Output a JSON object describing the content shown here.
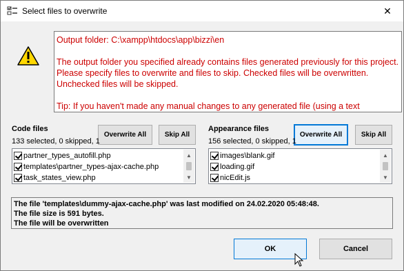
{
  "window": {
    "title": "Select files to overwrite",
    "close_glyph": "✕"
  },
  "message": {
    "line1": "Output folder: C:\\xampp\\htdocs\\app\\bizzi\\en",
    "line2": "The output folder you specified already contains files generated previously for this project. Please specify files to overwrite and files to skip. Checked files will be overwritten. Unchecked files will be skipped.",
    "line3": "Tip: If you haven't made any manual changes to any generated file (using a text"
  },
  "code_files": {
    "label": "Code files",
    "counts": "133 selected, 0 skipped, 1",
    "overwrite_all": "Overwrite All",
    "skip_all": "Skip All",
    "items": [
      {
        "name": "partner_types_autofill.php",
        "checked": true
      },
      {
        "name": "templates\\partner_types-ajax-cache.php",
        "checked": true
      },
      {
        "name": "task_states_view.php",
        "checked": true
      }
    ]
  },
  "appearance_files": {
    "label": "Appearance files",
    "counts": "156 selected, 0 skipped, 1",
    "overwrite_all": "Overwrite All",
    "skip_all": "Skip All",
    "items": [
      {
        "name": "images\\blank.gif",
        "checked": true
      },
      {
        "name": "loading.gif",
        "checked": true
      },
      {
        "name": "nicEdit.js",
        "checked": true
      }
    ]
  },
  "info": {
    "line1": "The file 'templates\\dummy-ajax-cache.php' was last modified on 24.02.2020 05:48:48.",
    "line2": "The file size is 591 bytes.",
    "line3": "The file will be overwritten"
  },
  "buttons": {
    "ok": "OK",
    "cancel": "Cancel"
  },
  "icons": {
    "window": "checklist-icon",
    "warning": "warning-icon",
    "scroll_up": "chevron-up-icon",
    "scroll_down": "chevron-down-icon",
    "cursor": "mouse-pointer-icon"
  },
  "colors": {
    "message_text": "#cc0000",
    "focus_border": "#0078d7"
  }
}
